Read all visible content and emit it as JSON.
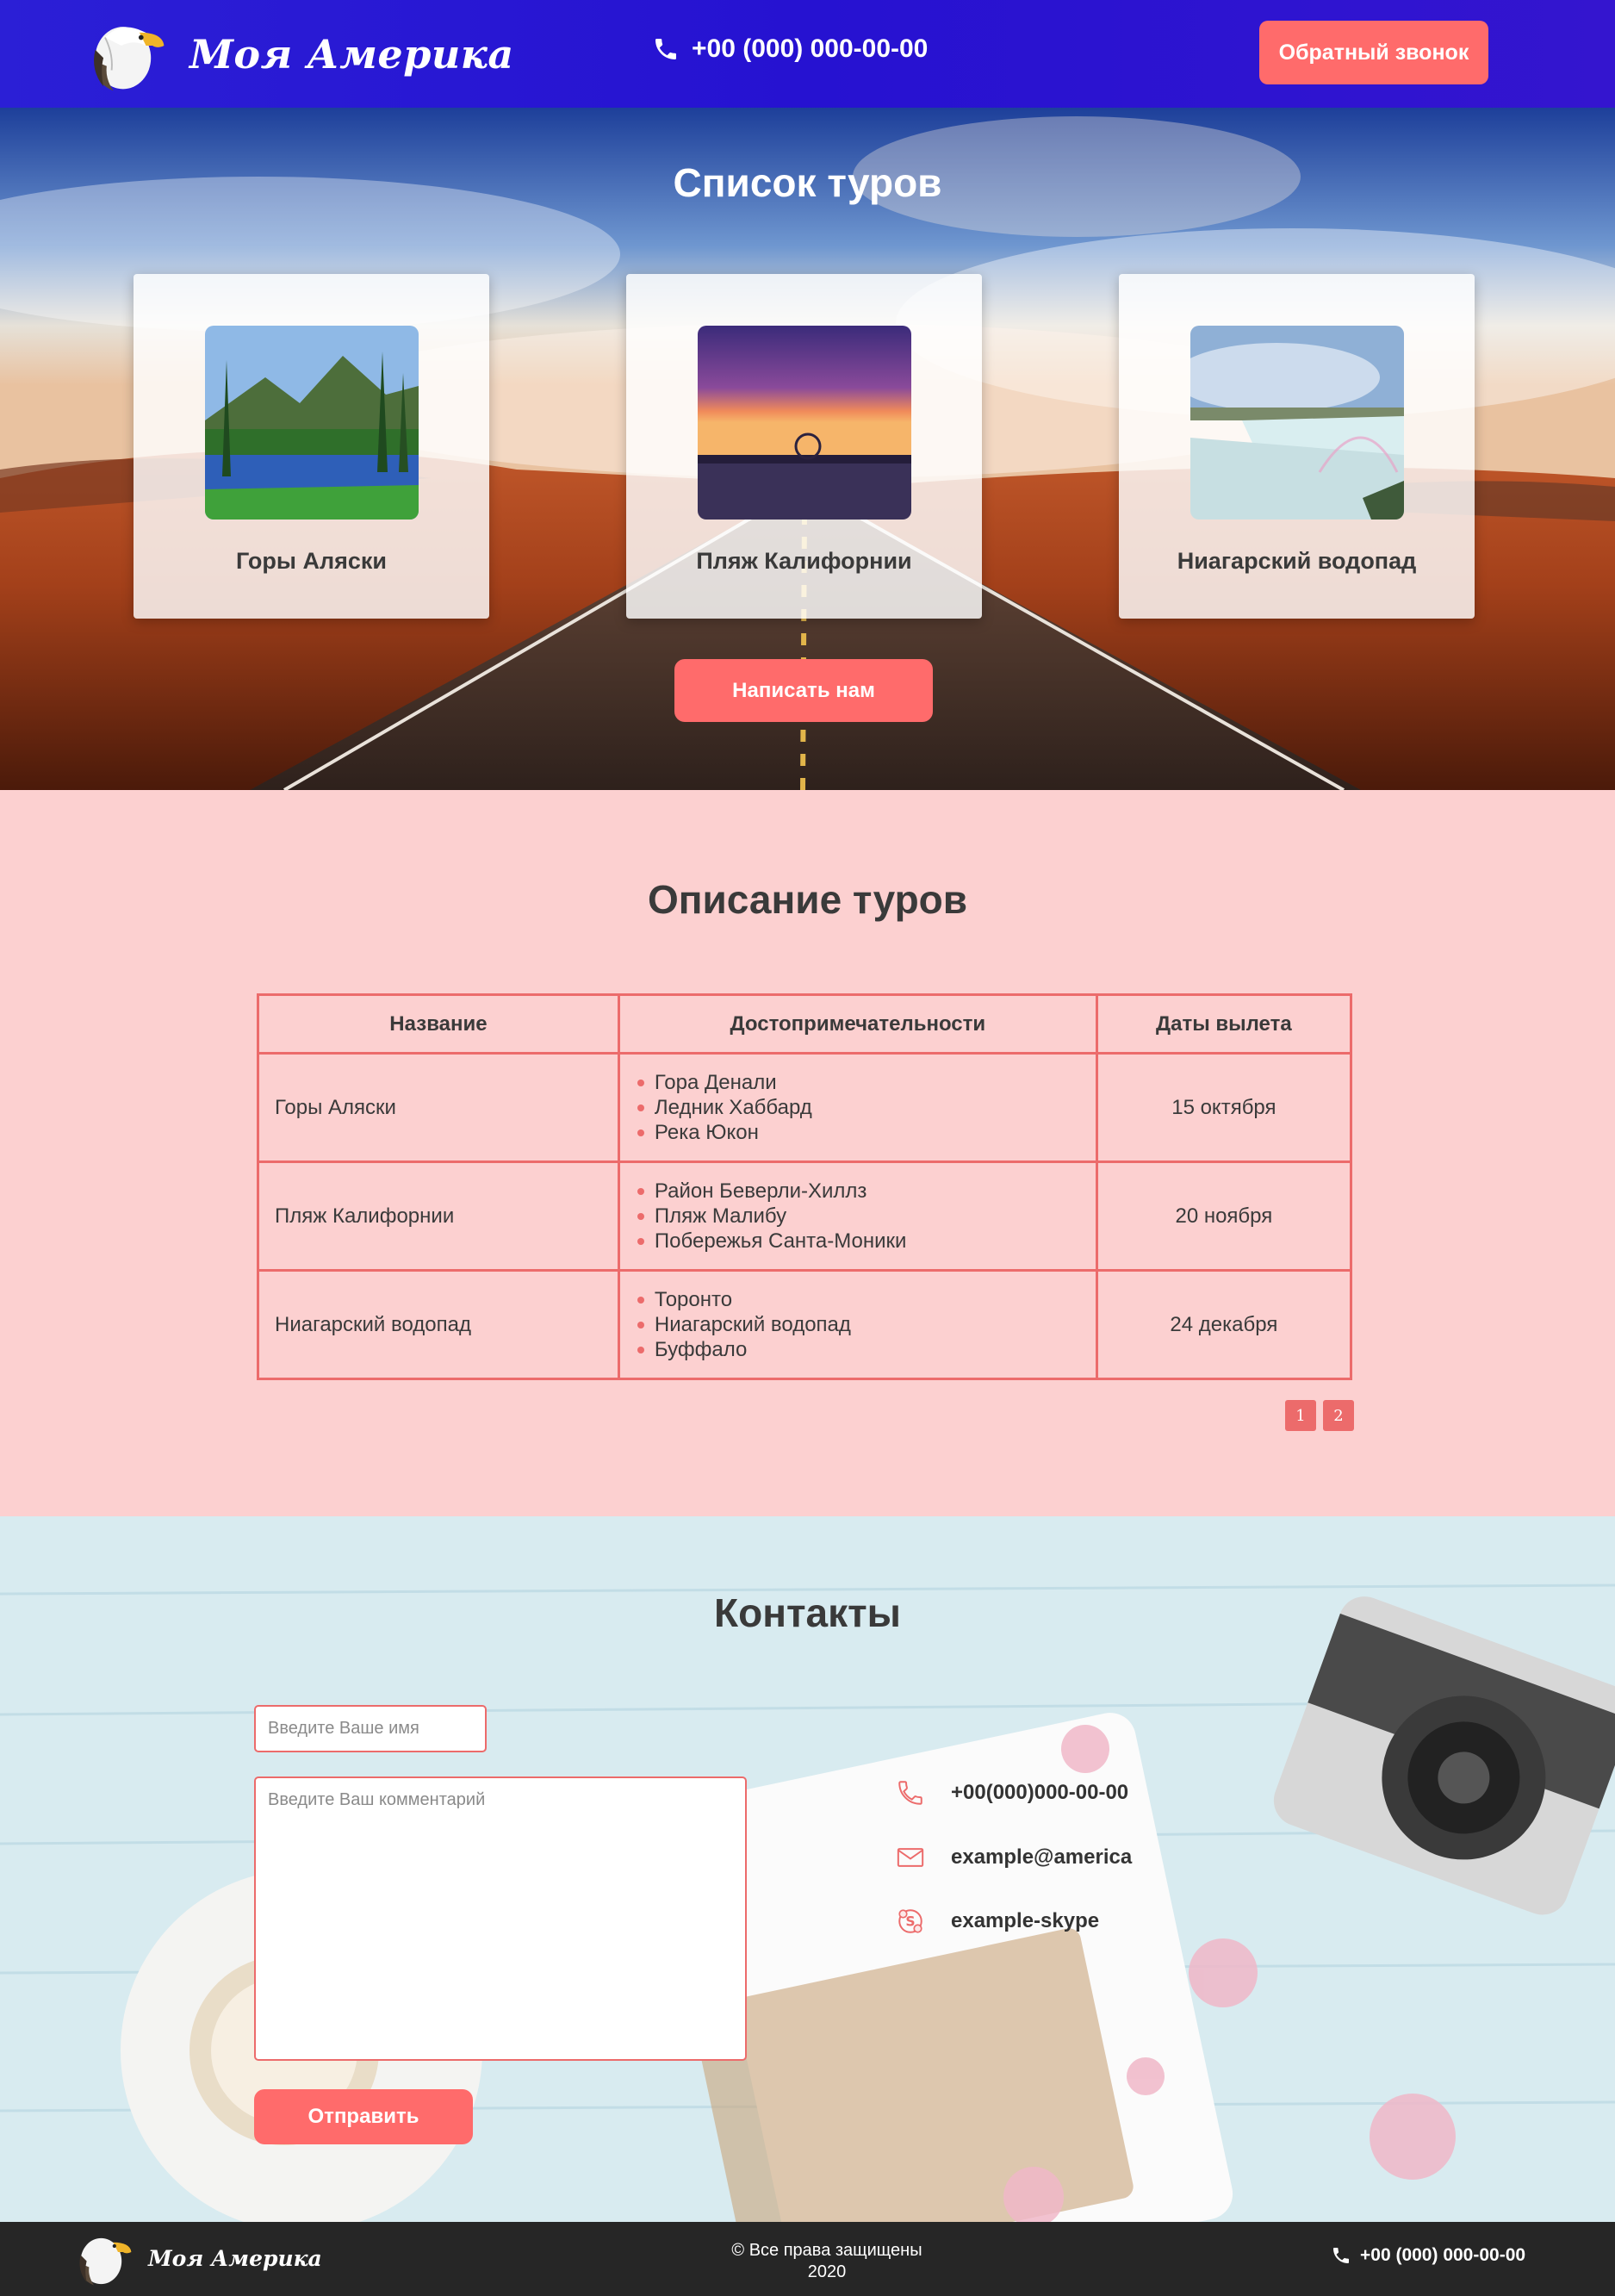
{
  "header": {
    "brand": "Моя Америка",
    "phone": "+00 (000) 000-00-00",
    "callback_label": "Обратный звонок"
  },
  "hero": {
    "title": "Список туров",
    "cards": [
      {
        "title": "Горы Аляски",
        "image": "alaska-mountains-photo"
      },
      {
        "title": "Пляж Калифорнии",
        "image": "california-beach-sunset-photo"
      },
      {
        "title": "Ниагарский водопад",
        "image": "niagara-falls-photo"
      }
    ],
    "write_label": "Написать нам"
  },
  "description": {
    "title": "Описание туров",
    "columns": [
      "Название",
      "Достопримечательности",
      "Даты вылета"
    ],
    "rows": [
      {
        "name": "Горы Аляски",
        "sights": [
          "Гора Денали",
          "Ледник Хаббард",
          "Река Юкон"
        ],
        "date": "15 октября"
      },
      {
        "name": "Пляж Калифорнии",
        "sights": [
          "Район Беверли-Хиллз",
          "Пляж Малибу",
          "Побережья Санта-Моники"
        ],
        "date": "20 ноября"
      },
      {
        "name": "Ниагарский водопад",
        "sights": [
          "Торонто",
          "Ниагарский водопад",
          "Буффало"
        ],
        "date": "24 декабря"
      }
    ],
    "pages": [
      "1",
      "2"
    ]
  },
  "contacts": {
    "title": "Контакты",
    "name_placeholder": "Введите Ваше имя",
    "comment_placeholder": "Введите Ваш комментарий",
    "send_label": "Отправить",
    "phone": "+00(000)000-00-00",
    "email": "example@america",
    "skype": "example-skype"
  },
  "footer": {
    "brand": "Моя Америка",
    "copyright": "© Все права защищены",
    "year": "2020",
    "phone": "+00 (000) 000-00-00"
  },
  "colors": {
    "header_bg": "#2612d1",
    "accent": "#ff6b6b",
    "table_border": "#ec6b6b",
    "desc_bg": "#fcd0d0",
    "footer_bg": "#262626"
  }
}
